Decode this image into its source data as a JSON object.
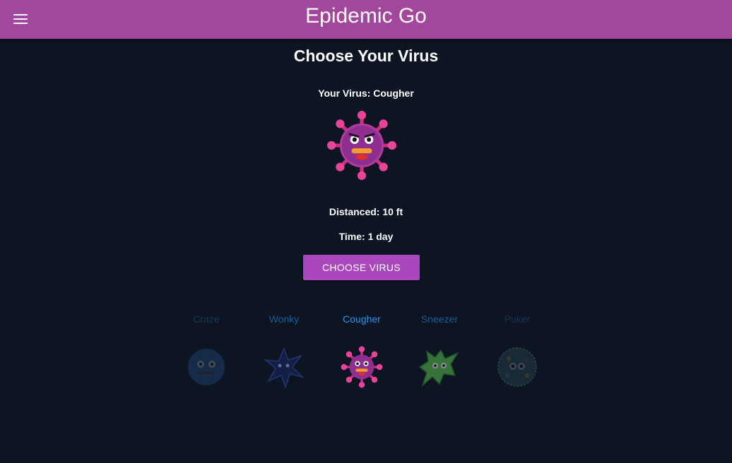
{
  "appbar": {
    "title": "Epidemic Go",
    "menu_icon": "hamburger-menu-icon",
    "color": "#a2479c"
  },
  "main": {
    "title": "Choose Your Virus",
    "selected_label": "Your Virus: Cougher",
    "distance": "Distanced: 10 ft",
    "time": "Time: 1 day",
    "choose_button": "CHOOSE VIRUS",
    "button_color": "#ab47bc"
  },
  "carousel": {
    "link_color": "#2196f3",
    "selected": "Cougher",
    "viruses": [
      {
        "name": "Craze",
        "icon": "craze-virus-icon",
        "emphasis": 0.25
      },
      {
        "name": "Wonky",
        "icon": "wonky-virus-icon",
        "emphasis": 0.55
      },
      {
        "name": "Cougher",
        "icon": "cougher-virus-icon",
        "emphasis": 1.0
      },
      {
        "name": "Sneezer",
        "icon": "sneezer-virus-icon",
        "emphasis": 0.55
      },
      {
        "name": "Puker",
        "icon": "puker-virus-icon",
        "emphasis": 0.25
      }
    ]
  }
}
